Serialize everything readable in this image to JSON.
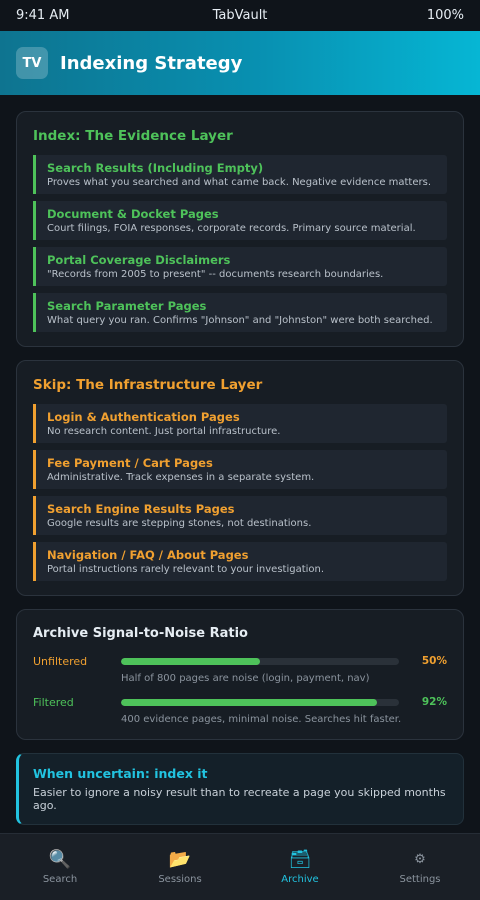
{
  "status": {
    "time": "9:41 AM",
    "carrier": "TabVault",
    "battery": "100%"
  },
  "header": {
    "logo": "TV",
    "title": "Indexing Strategy"
  },
  "index_card": {
    "title": "Index: The Evidence Layer",
    "items": [
      {
        "title": "Search Results (Including Empty)",
        "desc": "Proves what you searched and what came back. Negative evidence matters."
      },
      {
        "title": "Document & Docket Pages",
        "desc": "Court filings, FOIA responses, corporate records. Primary source material."
      },
      {
        "title": "Portal Coverage Disclaimers",
        "desc": "\"Records from 2005 to present\" -- documents research boundaries."
      },
      {
        "title": "Search Parameter Pages",
        "desc": "What query you ran. Confirms \"Johnson\" and \"Johnston\" were both searched."
      }
    ]
  },
  "skip_card": {
    "title": "Skip: The Infrastructure Layer",
    "items": [
      {
        "title": "Login & Authentication Pages",
        "desc": "No research content. Just portal infrastructure."
      },
      {
        "title": "Fee Payment / Cart Pages",
        "desc": "Administrative. Track expenses in a separate system."
      },
      {
        "title": "Search Engine Results Pages",
        "desc": "Google results are stepping stones, not destinations."
      },
      {
        "title": "Navigation / FAQ / About Pages",
        "desc": "Portal instructions rarely relevant to your investigation."
      }
    ]
  },
  "ratio": {
    "title": "Archive Signal-to-Noise Ratio",
    "rows": [
      {
        "label": "Unfiltered",
        "value": 50,
        "pct": "50%",
        "note": "Half of 800 pages are noise (login, payment, nav)"
      },
      {
        "label": "Filtered",
        "value": 92,
        "pct": "92%",
        "note": "400 evidence pages, minimal noise. Searches hit faster."
      }
    ]
  },
  "tip": {
    "title": "When uncertain: index it",
    "text": "Easier to ignore a noisy result than to recreate a page you skipped months ago."
  },
  "tabs": [
    {
      "icon": "🔍",
      "label": "Search"
    },
    {
      "icon": "📂",
      "label": "Sessions"
    },
    {
      "icon": "🗃",
      "label": "Archive"
    },
    {
      "icon": "⚙",
      "label": "Settings"
    }
  ],
  "colors": {
    "accent": "#22c3e0",
    "index": "#4ec25a",
    "skip": "#f0a030"
  }
}
